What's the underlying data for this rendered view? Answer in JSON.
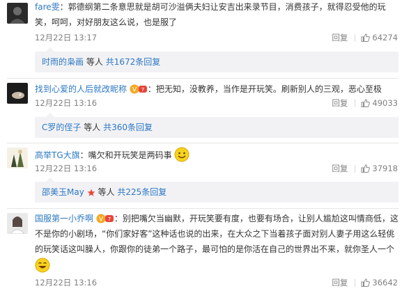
{
  "comments": [
    {
      "user": "fare雯",
      "text_lines": [
        "：郭德纲第二条意思就是胡可沙溢俩夫妇让安吉出来录节目，消费孩子，就得忍受他的玩",
        "笑，呵呵，对好朋友这么说，也是服了"
      ],
      "time": "12月22日 13:17",
      "reply_label": "回复",
      "likes": "64274",
      "sub": {
        "first_user": "时雨的枭画",
        "mid": "等人",
        "count_text": "共1672条回复",
        "tail": ""
      }
    },
    {
      "user": "找到心爱的人后就改昵称",
      "text_lines": [
        "：把无知，没教养，当作是开玩笑。刷新别人的三观，恶心至极"
      ],
      "time": "12月22日 13:16",
      "reply_label": "回复",
      "likes": "49033",
      "sub": {
        "first_user": "C罗的侄子",
        "mid": "等人",
        "count_text": "共360条",
        "tail": "回复"
      }
    },
    {
      "user": "高举TG大旗",
      "text_lines": [
        "：嘴欠和开玩笑是两码事"
      ],
      "time": "12月22日 13:16",
      "reply_label": "回复",
      "likes": "37918",
      "sub": {
        "first_user": "邵美玉May",
        "mid": "等人",
        "count_text": "共225条回复",
        "tail": ""
      }
    },
    {
      "user": "国服第一小乔啊",
      "text_lines": [
        "：别把嘴欠当幽默，开玩笑要有度，也要有场合，让别人尴尬这叫情商低，这",
        "不是你的小剧场，“你们家好客”这种话也说的出来，在大众之下当着孩子面对别人妻子用这么轻佻",
        "的玩笑话这叫臊人，你跟你的徒弟一个路子，最可怕的是你活在自己的世界出不来，就你圣人一个"
      ],
      "time": "12月22日 13:16",
      "reply_label": "回复",
      "likes": "36642"
    }
  ],
  "colors": {
    "link": "#2c78c4",
    "meta": "#808080",
    "subbar": "#f2f2f5",
    "badge": "#f5a623",
    "vip": "#e8463c"
  }
}
